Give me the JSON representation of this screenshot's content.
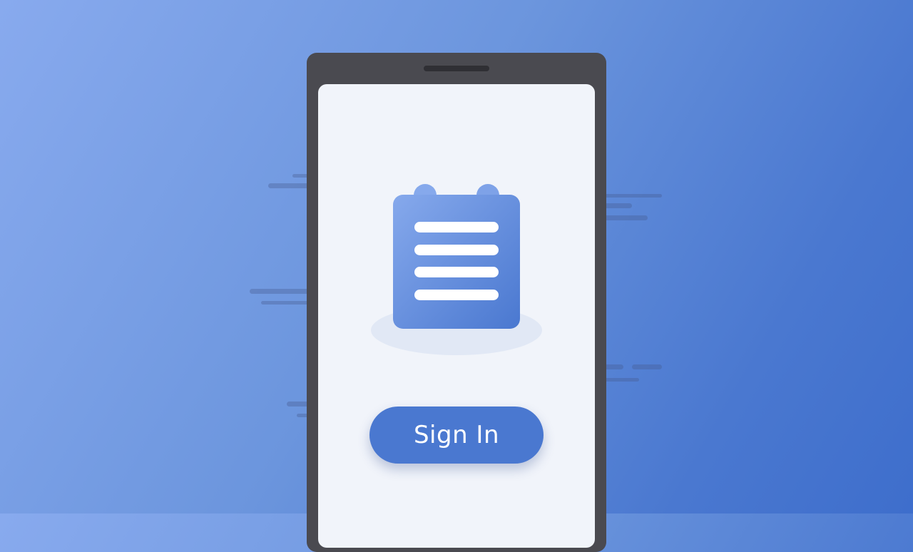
{
  "screen": {
    "signin_label": "Sign In"
  },
  "icons": {
    "notepad": "notepad-icon"
  },
  "colors": {
    "background_start": "#88aaee",
    "background_end": "#3e6ecc",
    "phone_frame": "#4a4a50",
    "screen_background": "#f1f4fa",
    "accent": "#4a78d0",
    "button_text": "#ffffff"
  }
}
